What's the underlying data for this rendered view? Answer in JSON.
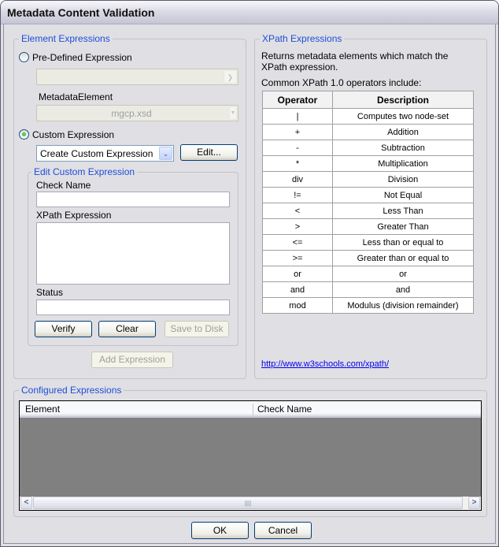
{
  "window": {
    "title": "Metadata Content Validation"
  },
  "element_expressions": {
    "group_label": "Element Expressions",
    "predefined_radio_label": "Pre-Defined Expression",
    "predefined_selected": false,
    "predefined_combo_value": "",
    "metadata_element_label": "MetadataElement",
    "metadata_element_value": "mgcp.xsd",
    "custom_radio_label": "Custom Expression",
    "custom_selected": true,
    "custom_combo_value": "Create Custom Expression",
    "edit_button": "Edit...",
    "edit_custom": {
      "group_label": "Edit Custom Expression",
      "check_name_label": "Check Name",
      "check_name_value": "",
      "xpath_label": "XPath Expression",
      "xpath_value": "",
      "status_label": "Status",
      "status_value": "",
      "verify_button": "Verify",
      "clear_button": "Clear",
      "save_button": "Save to Disk"
    },
    "add_expression_button": "Add Expression"
  },
  "xpath_expressions": {
    "group_label": "XPath Expressions",
    "description": "Returns metadata elements which match the XPath expression.",
    "operators_intro": "Common XPath 1.0 operators include:",
    "table": {
      "headers": [
        "Operator",
        "Description"
      ],
      "rows": [
        [
          "|",
          "Computes two node-set"
        ],
        [
          "+",
          "Addition"
        ],
        [
          "-",
          "Subtraction"
        ],
        [
          "*",
          "Multiplication"
        ],
        [
          "div",
          "Division"
        ],
        [
          "!=",
          "Not Equal"
        ],
        [
          "<",
          "Less Than"
        ],
        [
          ">",
          "Greater Than"
        ],
        [
          "<=",
          "Less than or equal to"
        ],
        [
          ">=",
          "Greater than or equal to"
        ],
        [
          "or",
          "or"
        ],
        [
          "and",
          "and"
        ],
        [
          "mod",
          "Modulus (division remainder)"
        ]
      ]
    },
    "link": "http://www.w3schools.com/xpath/"
  },
  "configured_expressions": {
    "group_label": "Configured Expressions",
    "columns": [
      "Element",
      "Check Name"
    ],
    "rows": [],
    "scroll_left": "<",
    "scroll_right": ">",
    "scroll_grip": "||||"
  },
  "footer": {
    "ok_button": "OK",
    "cancel_button": "Cancel"
  },
  "colors": {
    "group_label": "#1d4ed8",
    "link": "#0000ee",
    "list_background": "#808080"
  }
}
